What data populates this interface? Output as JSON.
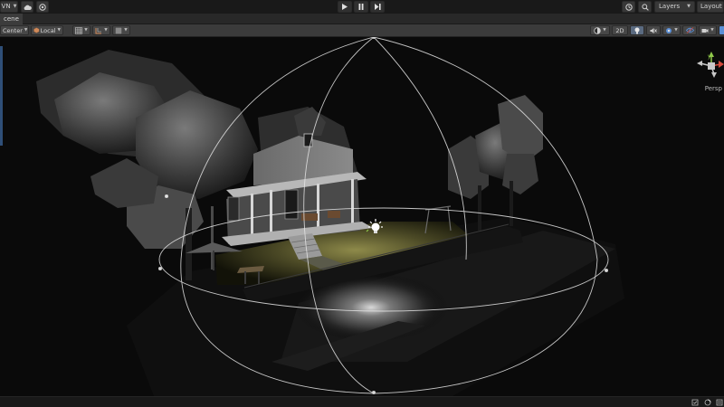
{
  "toolbar": {
    "account_label": "VN",
    "layers_label": "Layers",
    "layout_label": "Layout"
  },
  "tab": {
    "title": "cene"
  },
  "scene_toolbar": {
    "pivot_label": "Center",
    "space_label": "Local",
    "mode_2d_label": "2D"
  },
  "viewport": {
    "view_label": "Persp",
    "gizmo_axis_label": "y"
  },
  "colors": {
    "toolbar_bg": "#191919",
    "scene_toolbar_bg": "#3b3b3b",
    "accent_blue": "#5a8fd6",
    "gizmo_green": "#8fc84a",
    "gizmo_red": "#d24a3c",
    "light_color": "#ffffff"
  },
  "icons": {
    "cloud": "cloud-icon",
    "collab": "collab-icon",
    "play": "play-icon",
    "pause": "pause-icon",
    "step": "step-icon",
    "history": "history-icon",
    "search": "search-icon",
    "light_bulb": "point-light-icon"
  }
}
